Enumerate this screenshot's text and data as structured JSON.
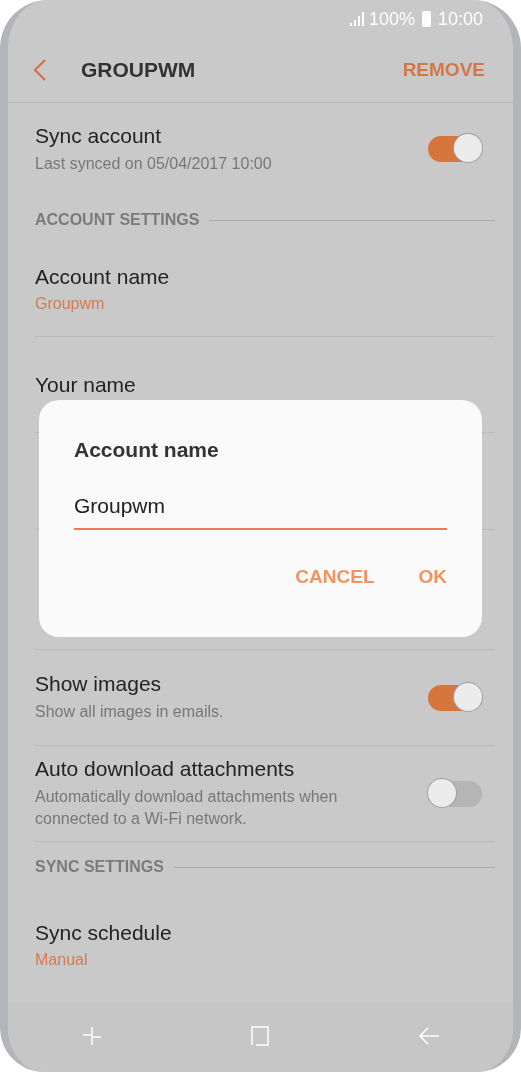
{
  "status_bar": {
    "battery": "100%",
    "time": "10:00"
  },
  "header": {
    "title": "GROUPWM",
    "action": "REMOVE"
  },
  "settings": [
    {
      "kind": "toggle",
      "title": "Sync account",
      "subtitle": "Last synced on 05/04/2017  10:00",
      "on": true
    },
    {
      "kind": "section",
      "title": "ACCOUNT SETTINGS"
    },
    {
      "kind": "value",
      "title": "Account name",
      "value": "Groupwm"
    },
    {
      "kind": "value",
      "title": "Your name"
    },
    {
      "kind": "obscured"
    },
    {
      "kind": "toggle",
      "title": "Show images",
      "subtitle": "Show all images in emails.",
      "on": true
    },
    {
      "kind": "toggle",
      "title": "Auto download attachments",
      "subtitle": "Automatically download attachments when connected to a Wi-Fi network.",
      "on": false
    },
    {
      "kind": "section",
      "title": "SYNC SETTINGS"
    },
    {
      "kind": "value",
      "title": "Sync schedule",
      "value": "Manual"
    }
  ],
  "dialog": {
    "title": "Account name",
    "value": "Groupwm",
    "buttons": [
      "CANCEL",
      "OK"
    ]
  }
}
